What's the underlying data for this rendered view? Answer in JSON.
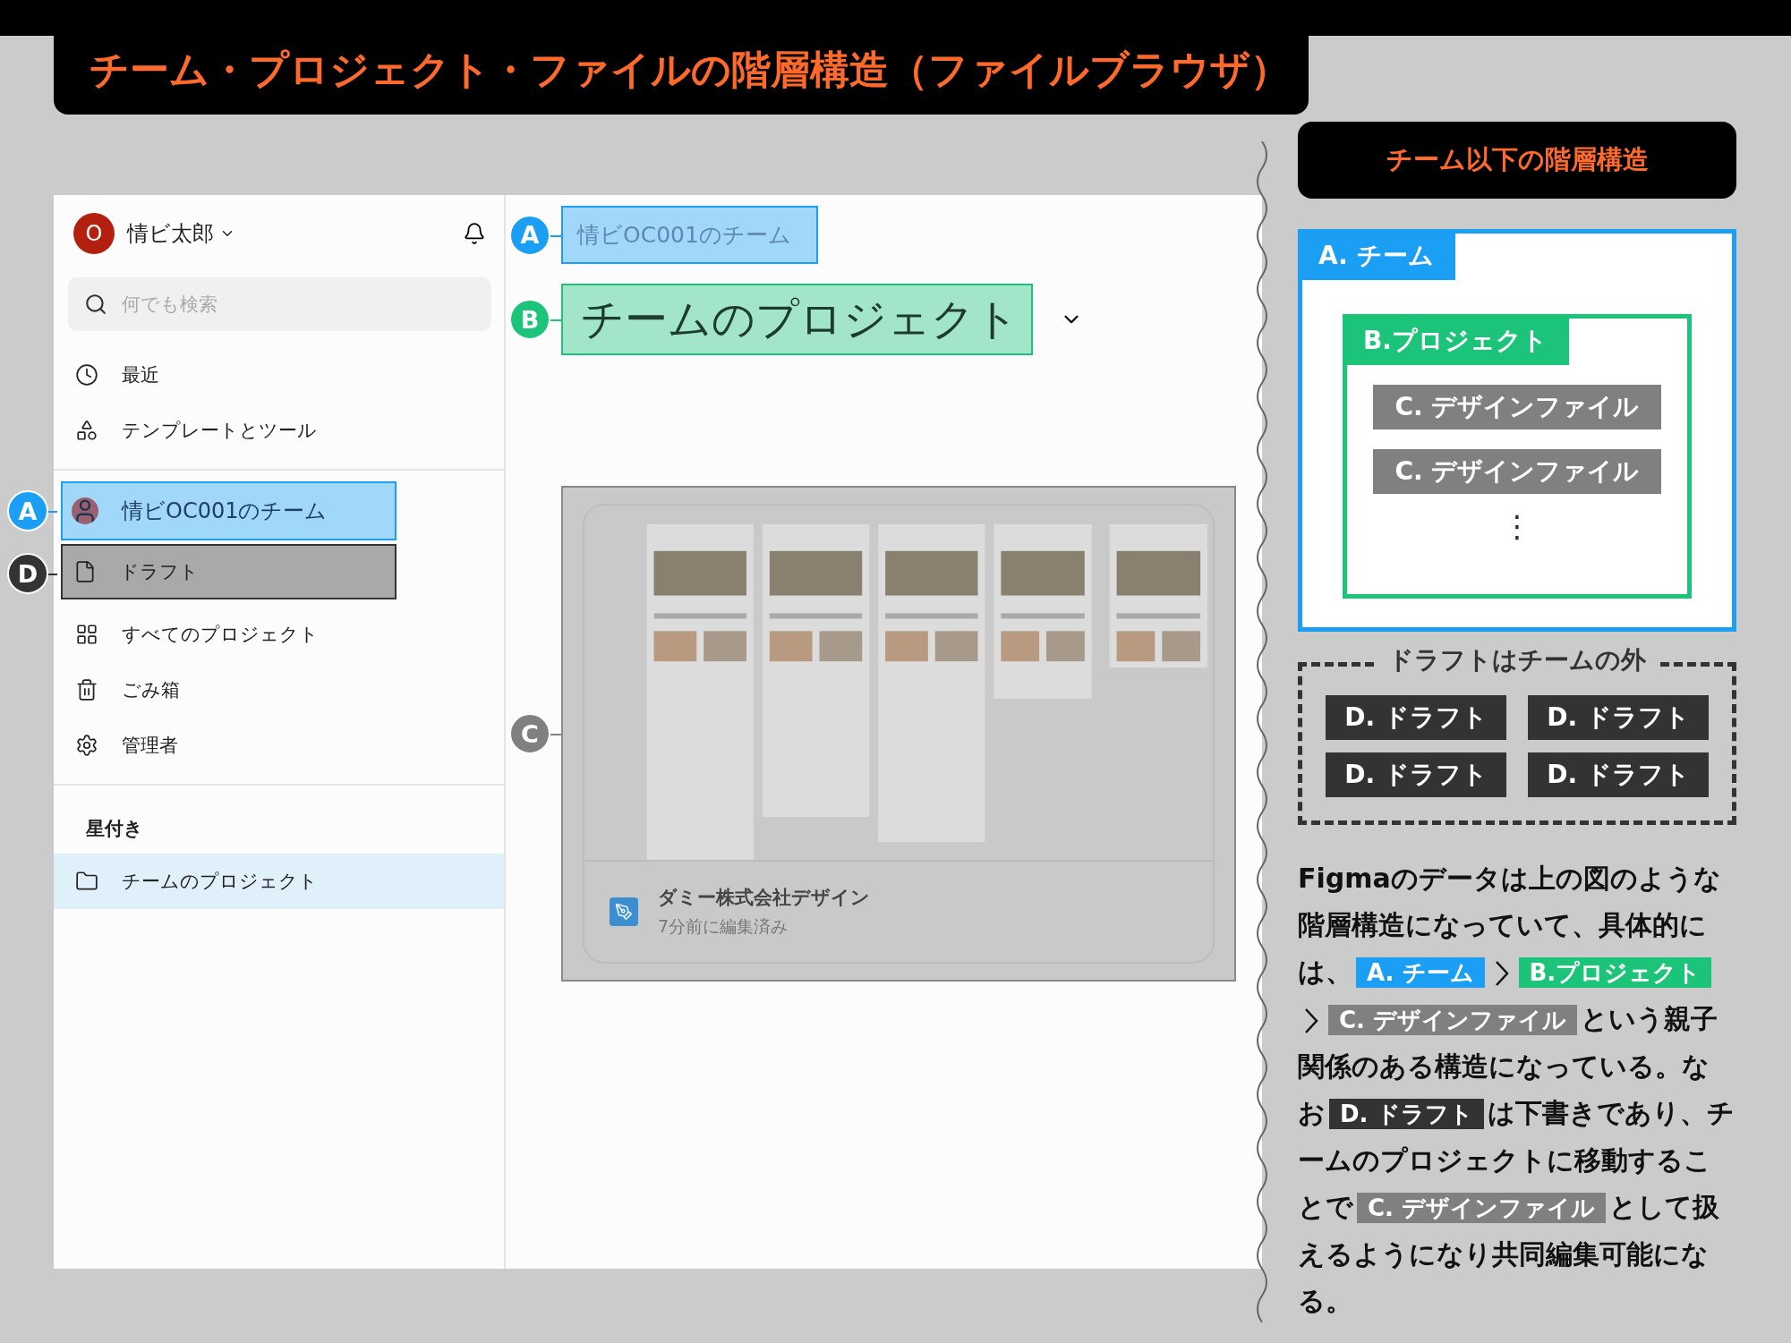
{
  "title": "チーム・プロジェクト・ファイルの階層構造（ファイルブラウザ）",
  "sidebar": {
    "user": {
      "avatar_letter": "O",
      "name": "情ビ太郎"
    },
    "search": {
      "placeholder": "何でも検索"
    },
    "nav": [
      {
        "label": "最近"
      },
      {
        "label": "テンプレートとツール"
      }
    ],
    "team": {
      "label": "情ビOC001のチーム",
      "callout": {
        "letter": "A",
        "color": "#1a9ff5"
      }
    },
    "team_items": [
      {
        "label": "ドラフト",
        "callout": {
          "letter": "D",
          "color": "#333333"
        }
      },
      {
        "label": "すべてのプロジェクト"
      },
      {
        "label": "ごみ箱"
      },
      {
        "label": "管理者"
      }
    ],
    "starred": {
      "heading": "星付き",
      "items": [
        {
          "label": "チームのプロジェクト",
          "selected": true
        }
      ]
    }
  },
  "main": {
    "team_label": {
      "text": "情ビOC001のチーム",
      "callout": {
        "letter": "A",
        "color": "#1a9ff5"
      }
    },
    "project_title": {
      "text": "チームのプロジェクト",
      "callout": {
        "letter": "B",
        "color": "#1cc47a"
      }
    },
    "file_card": {
      "name": "ダミー株式会社デザイン",
      "edited": "7分前に編集済み",
      "callout": {
        "letter": "C",
        "color": "#808080"
      }
    }
  },
  "hierarchy": {
    "heading": "チーム以下の階層構造",
    "team_label": "A. チーム",
    "project_label": "B.プロジェクト",
    "files": [
      "C. デザインファイル",
      "C. デザインファイル"
    ],
    "more": "⋮"
  },
  "drafts": {
    "heading": "ドラフトはチームの外",
    "items": [
      "D. ドラフト",
      "D. ドラフト",
      "D. ドラフト",
      "D. ドラフト"
    ]
  },
  "description": [
    {
      "kind": "text",
      "text": "Figmaのデータは上の図のような階層構造になっていて、具体的には、"
    },
    {
      "kind": "chip",
      "text": "A. チーム",
      "color": "#1a9ff5"
    },
    {
      "kind": "arrow"
    },
    {
      "kind": "chip",
      "text": "B.プロジェクト",
      "color": "#1cc47a"
    },
    {
      "kind": "arrow"
    },
    {
      "kind": "chip",
      "text": "C. デザインファイル",
      "color": "#808080"
    },
    {
      "kind": "text",
      "text": "という親子関係のある構造になっている。なお"
    },
    {
      "kind": "chip",
      "text": "D. ドラフト",
      "color": "#333333"
    },
    {
      "kind": "text",
      "text": "は下書きであり、チームのプロジェクトに移動することで"
    },
    {
      "kind": "chip",
      "text": "C. デザインファイル",
      "color": "#808080"
    },
    {
      "kind": "text",
      "text": "として扱えるようになり共同編集可能になる。"
    }
  ]
}
